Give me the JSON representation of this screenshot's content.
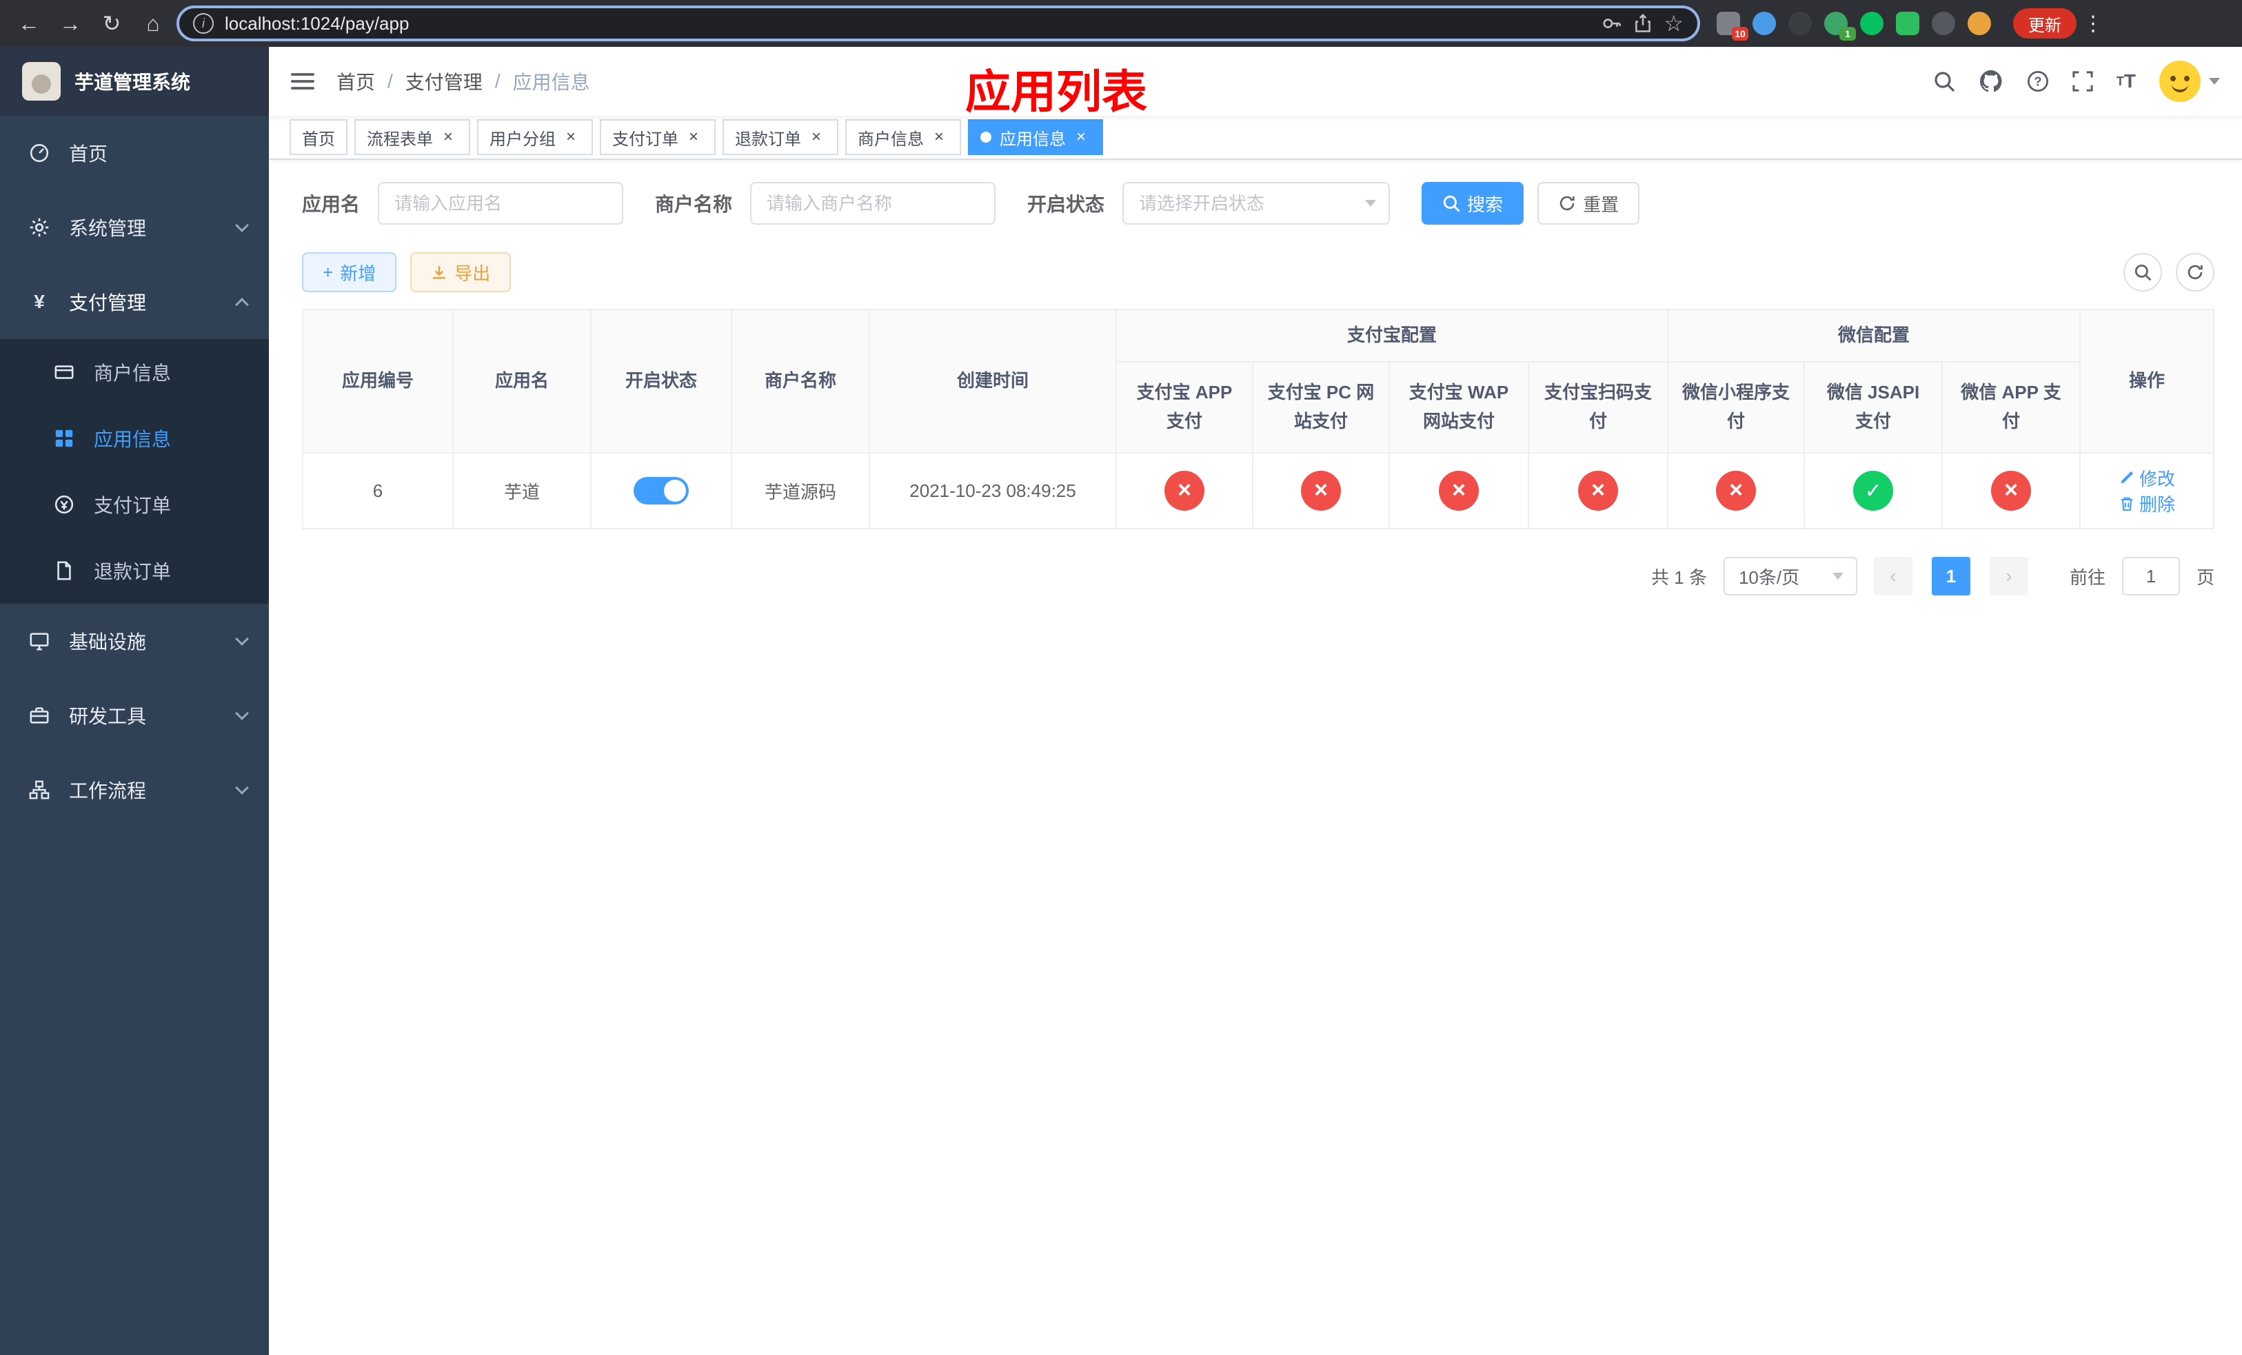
{
  "browser": {
    "url": "localhost:1024/pay/app",
    "update_button": "更新",
    "badges": {
      "puzzle": "10",
      "green": "1"
    }
  },
  "annotation": {
    "title": "应用列表"
  },
  "sidebar": {
    "logo_title": "芋道管理系统",
    "menu": [
      {
        "label": "首页"
      },
      {
        "label": "系统管理"
      },
      {
        "label": "支付管理"
      },
      {
        "label": "基础设施"
      },
      {
        "label": "研发工具"
      },
      {
        "label": "工作流程"
      }
    ],
    "submenu": [
      {
        "label": "商户信息"
      },
      {
        "label": "应用信息"
      },
      {
        "label": "支付订单"
      },
      {
        "label": "退款订单"
      }
    ]
  },
  "breadcrumb": {
    "separator": "/",
    "items": [
      "首页",
      "支付管理",
      "应用信息"
    ]
  },
  "tabs": [
    {
      "label": "首页"
    },
    {
      "label": "流程表单"
    },
    {
      "label": "用户分组"
    },
    {
      "label": "支付订单"
    },
    {
      "label": "退款订单"
    },
    {
      "label": "商户信息"
    },
    {
      "label": "应用信息"
    }
  ],
  "filters": {
    "app_name_label": "应用名",
    "app_name_placeholder": "请输入应用名",
    "merchant_label": "商户名称",
    "merchant_placeholder": "请输入商户名称",
    "status_label": "开启状态",
    "status_placeholder": "请选择开启状态",
    "search_button": "搜索",
    "reset_button": "重置"
  },
  "toolbar": {
    "add_button": "新增",
    "export_button": "导出"
  },
  "table": {
    "columns": {
      "id": "应用编号",
      "name": "应用名",
      "status": "开启状态",
      "merchant": "商户名称",
      "created": "创建时间",
      "alipay_group": "支付宝配置",
      "wechat_group": "微信配置",
      "alipay_app": "支付宝 APP 支付",
      "alipay_pc": "支付宝 PC 网站支付",
      "alipay_wap": "支付宝 WAP 网站支付",
      "alipay_qr": "支付宝扫码支付",
      "wechat_lite": "微信小程序支付",
      "wechat_jsapi": "微信 JSAPI 支付",
      "wechat_app": "微信 APP 支付",
      "actions": "操作"
    },
    "rows": [
      {
        "id": "6",
        "name": "芋道",
        "enabled": true,
        "merchant": "芋道源码",
        "created": "2021-10-23 08:49:25",
        "alipay_app": false,
        "alipay_pc": false,
        "alipay_wap": false,
        "alipay_qr": false,
        "wechat_lite": false,
        "wechat_jsapi": true,
        "wechat_app": false,
        "edit_label": "修改",
        "delete_label": "删除"
      }
    ]
  },
  "pagination": {
    "total": "共 1 条",
    "page_size": "10条/页",
    "current_page": "1",
    "goto_label": "前往",
    "goto_value": "1",
    "page_unit": "页"
  },
  "colors": {
    "primary": "#409eff",
    "success": "#13ce66",
    "danger": "#f24e49",
    "sidebar_bg": "#304156",
    "submenu_bg": "#1f2d3d"
  }
}
